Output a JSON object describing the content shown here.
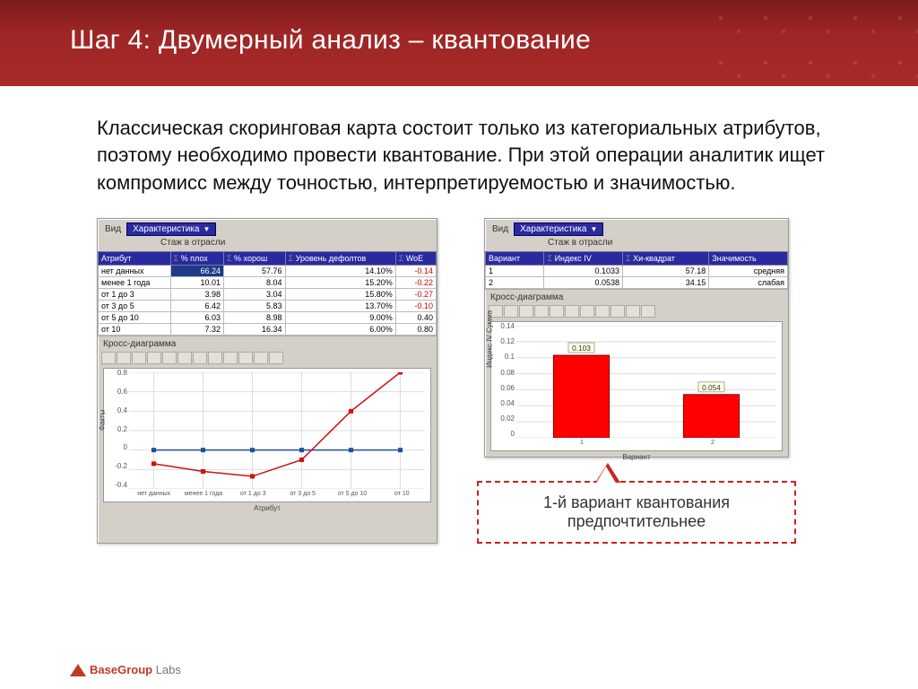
{
  "slide": {
    "title": "Шаг 4: Двумерный анализ – квантование",
    "body": "Классическая скоринговая карта состоит только из категориальных атрибутов, поэтому необходимо провести квантование. При этой операции аналитик ищет компромисс между точностью, интерпретируемостью и значимостью."
  },
  "left_panel": {
    "tab_label": "Вид",
    "dropdown": "Характеристика",
    "subtitle": "Стаж в отрасли",
    "columns": [
      "Атрибут",
      "% плох",
      "% хорош",
      "Уровень дефолтов",
      "WoE"
    ],
    "rows": [
      {
        "a": "нет данных",
        "b": "66.24",
        "c": "57.76",
        "d": "14.10%",
        "e": "-0.14"
      },
      {
        "a": "менее 1 года",
        "b": "10.01",
        "c": "8.04",
        "d": "15.20%",
        "e": "-0.22"
      },
      {
        "a": "от 1 до 3",
        "b": "3.98",
        "c": "3.04",
        "d": "15.80%",
        "e": "-0.27"
      },
      {
        "a": "от 3 до 5",
        "b": "6.42",
        "c": "5.83",
        "d": "13.70%",
        "e": "-0.10"
      },
      {
        "a": "от 5 до 10",
        "b": "6.03",
        "c": "8.98",
        "d": "9.00%",
        "e": "0.40"
      },
      {
        "a": "от 10",
        "b": "7.32",
        "c": "16.34",
        "d": "6.00%",
        "e": "0.80"
      }
    ],
    "cross_label": "Кросс-диаграмма"
  },
  "right_panel": {
    "tab_label": "Вид",
    "dropdown": "Характеристика",
    "subtitle": "Стаж в отрасли",
    "columns": [
      "Вариант",
      "Индекс IV",
      "Хи-квадрат",
      "Значимость"
    ],
    "rows": [
      {
        "a": "1",
        "b": "0.1033",
        "c": "57.18",
        "d": "средняя"
      },
      {
        "a": "2",
        "b": "0.0538",
        "c": "34.15",
        "d": "слабая"
      }
    ],
    "cross_label": "Кросс-диаграмма"
  },
  "chart_data": [
    {
      "type": "line",
      "title": "",
      "xlabel": "Атрибут",
      "ylabel": "Факты",
      "categories": [
        "нет данных",
        "менее 1 года",
        "от 1 до 3",
        "от 3 до 5",
        "от 5 до 10",
        "от 10"
      ],
      "series": [
        {
          "name": "zero",
          "values": [
            0,
            0,
            0,
            0,
            0,
            0
          ],
          "color": "#1e50a2"
        },
        {
          "name": "woe",
          "values": [
            -0.14,
            -0.22,
            -0.27,
            -0.1,
            0.4,
            0.8
          ],
          "color": "#d01010"
        }
      ],
      "ylim": [
        -0.4,
        0.8
      ],
      "yticks": [
        -0.4,
        -0.2,
        0,
        0.2,
        0.4,
        0.6,
        0.8
      ]
    },
    {
      "type": "bar",
      "title": "",
      "xlabel": "Вариант",
      "ylabel": "Индекс IV Сумма",
      "categories": [
        "1",
        "2"
      ],
      "values": [
        0.103,
        0.054
      ],
      "data_labels": [
        "0.103",
        "0.054"
      ],
      "ylim": [
        0,
        0.14
      ],
      "yticks": [
        0,
        0.02,
        0.04,
        0.06,
        0.08,
        0.1,
        0.12,
        0.14
      ]
    }
  ],
  "callout": "1-й вариант квантования предпочтительнее",
  "footer": {
    "brand": "BaseGroup",
    "suffix": " Labs"
  }
}
